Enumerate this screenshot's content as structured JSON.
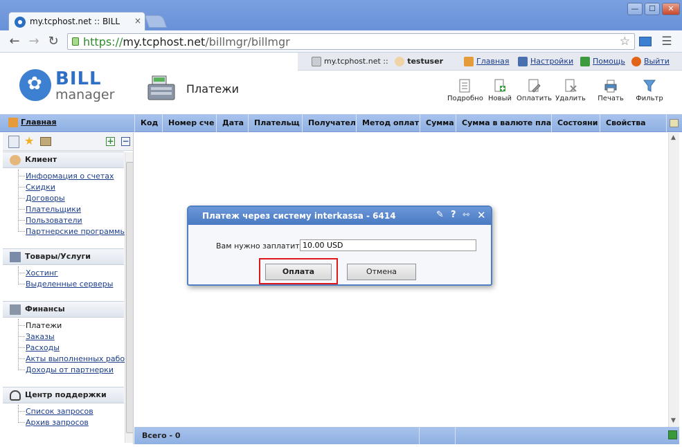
{
  "browser": {
    "tab_title": "my.tcphost.net :: BILL",
    "tab_close": "×",
    "win_minimize": "—",
    "win_maximize": "☐",
    "win_close": "✕",
    "url_scheme": "https://",
    "url_host": "my.tcphost.net",
    "url_path": "/billmgr/billmgr"
  },
  "infobar": {
    "host": "my.tcphost.net ::",
    "user": "testuser"
  },
  "topnav": {
    "home": "Главная",
    "settings": "Настройки",
    "help": "Помощь",
    "logout": "Выйти"
  },
  "logo": {
    "bill": "BILL",
    "manager": "manager"
  },
  "page_title": "Платежи",
  "toolbar": {
    "details": "Подробно",
    "new": "Новый",
    "pay": "Оплатить",
    "delete": "Удалить",
    "print": "Печать",
    "filter": "Фильтр"
  },
  "home_link": "Главная",
  "columns": [
    "Код",
    "Номер сче",
    "Дата",
    "Плательщ",
    "Получател",
    "Метод оплат",
    "Сумма",
    "Сумма в валюте пла",
    "Состояни",
    "Свойства"
  ],
  "sidebar": {
    "sections": [
      {
        "title": "Клиент",
        "items": [
          "Информация о счетах",
          "Скидки",
          "Договоры",
          "Плательщики",
          "Пользователи",
          "Партнерские программы"
        ]
      },
      {
        "title": "Товары/Услуги",
        "items": [
          "Хостинг",
          "Выделенные серверы"
        ]
      },
      {
        "title": "Финансы",
        "items": [
          "Платежи",
          "Заказы",
          "Расходы",
          "Акты выполненных работ",
          "Доходы от партнерки"
        ]
      },
      {
        "title": "Центр поддержки",
        "items": [
          "Список запросов",
          "Архив запросов"
        ]
      }
    ]
  },
  "footer": {
    "total": "Всего - 0"
  },
  "dialog": {
    "title": "Платеж через систему interkassa - 6414",
    "amount_label": "Вам нужно заплатить",
    "amount_value": "10.00 USD",
    "pay_button": "Оплата",
    "cancel_button": "Отмена"
  },
  "colors": {
    "accent": "#4a7ac2",
    "grid_header": "#a9c3ec",
    "highlight": "#e0161b"
  }
}
